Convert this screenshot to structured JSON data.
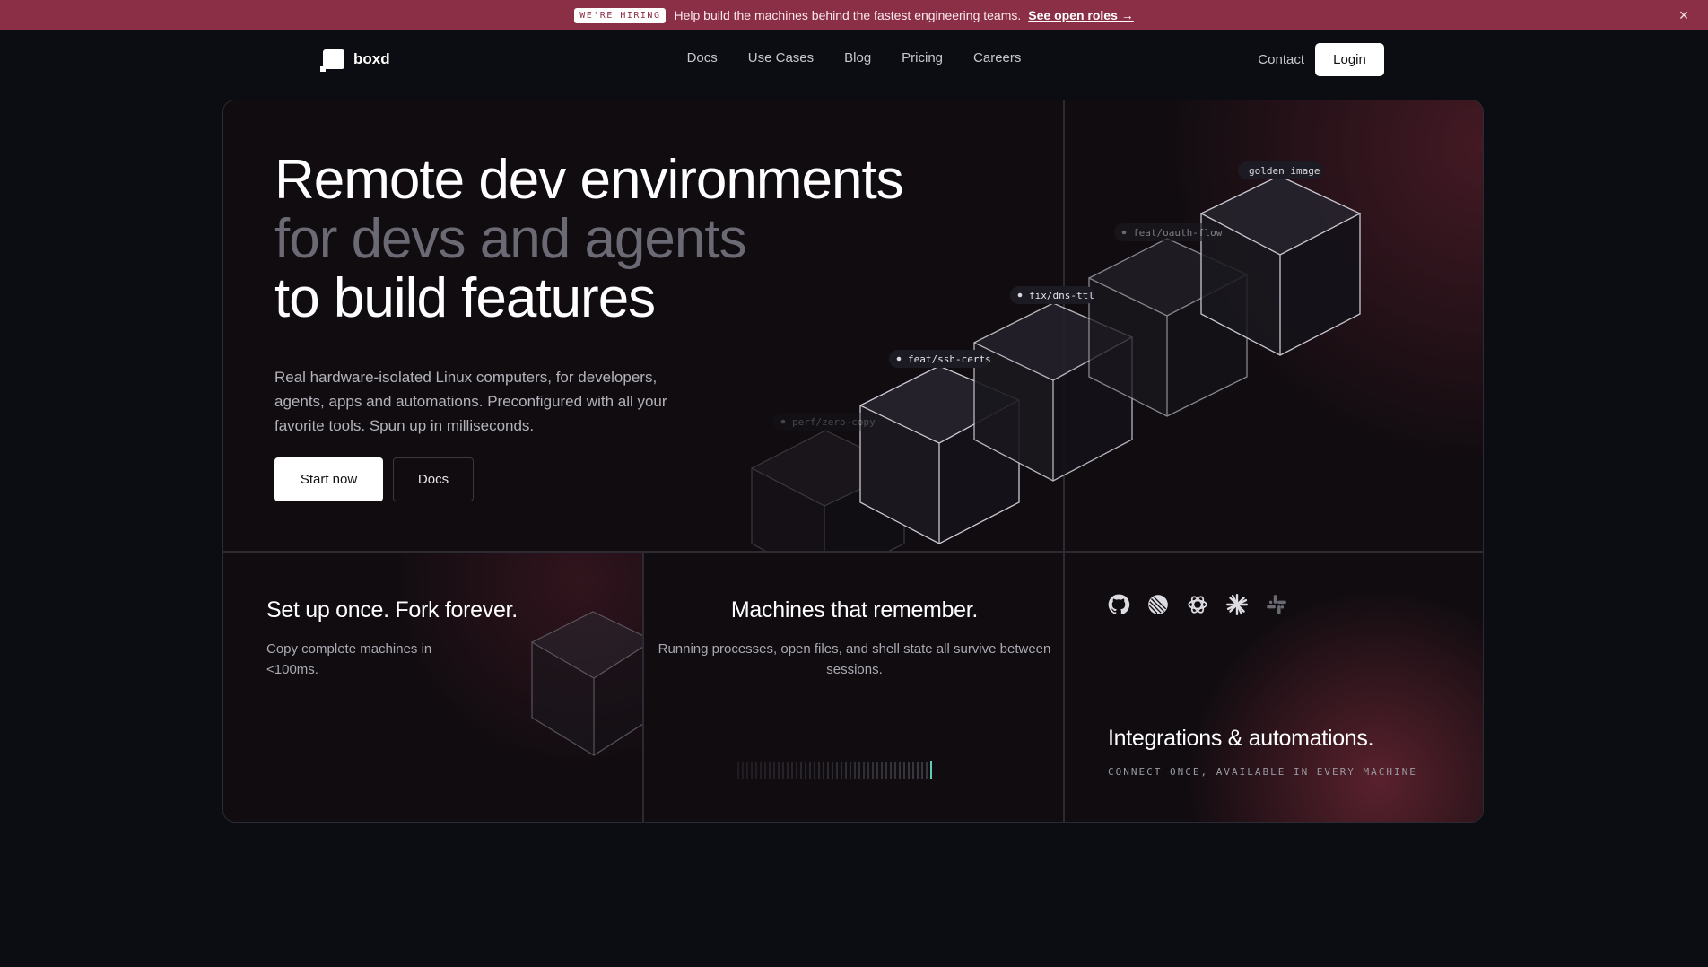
{
  "banner": {
    "badge": "WE'RE HIRING",
    "text": "Help build the machines behind the fastest engineering teams.",
    "link": "See open roles →",
    "close_icon": "×"
  },
  "nav": {
    "logo_text": "boxd",
    "links": [
      "Docs",
      "Use Cases",
      "Blog",
      "Pricing",
      "Careers"
    ],
    "contact": "Contact",
    "login": "Login"
  },
  "hero": {
    "title_line1": "Remote dev environments",
    "title_line2": "for devs and agents",
    "title_line3": "to build features",
    "description": "Real hardware-isolated Linux computers, for developers, agents, apps and automations. Preconfigured with all your favorite tools. Spun up in milliseconds.",
    "primary_button": "Start now",
    "secondary_button": "Docs"
  },
  "cube_labels": [
    "golden image",
    "feat/oauth-flow",
    "fix/dns-ttl",
    "feat/ssh-certs",
    "perf/zero-copy"
  ],
  "features": {
    "fork": {
      "title": "Set up once. Fork forever.",
      "desc": "Copy complete machines in <100ms."
    },
    "memory": {
      "title": "Machines that remember.",
      "desc": "Running processes, open files, and shell state all survive between sessions."
    },
    "integrations": {
      "title": "Integrations & automations.",
      "subtitle": "CONNECT ONCE, AVAILABLE IN EVERY MACHINE",
      "icons": [
        "github-icon",
        "linear-icon",
        "openai-icon",
        "claude-icon",
        "slack-icon"
      ]
    }
  },
  "colors": {
    "banner": "#8a2f45",
    "background": "#0c0d12",
    "card": "#100c10",
    "accent_tick": "#5fd0b8"
  }
}
